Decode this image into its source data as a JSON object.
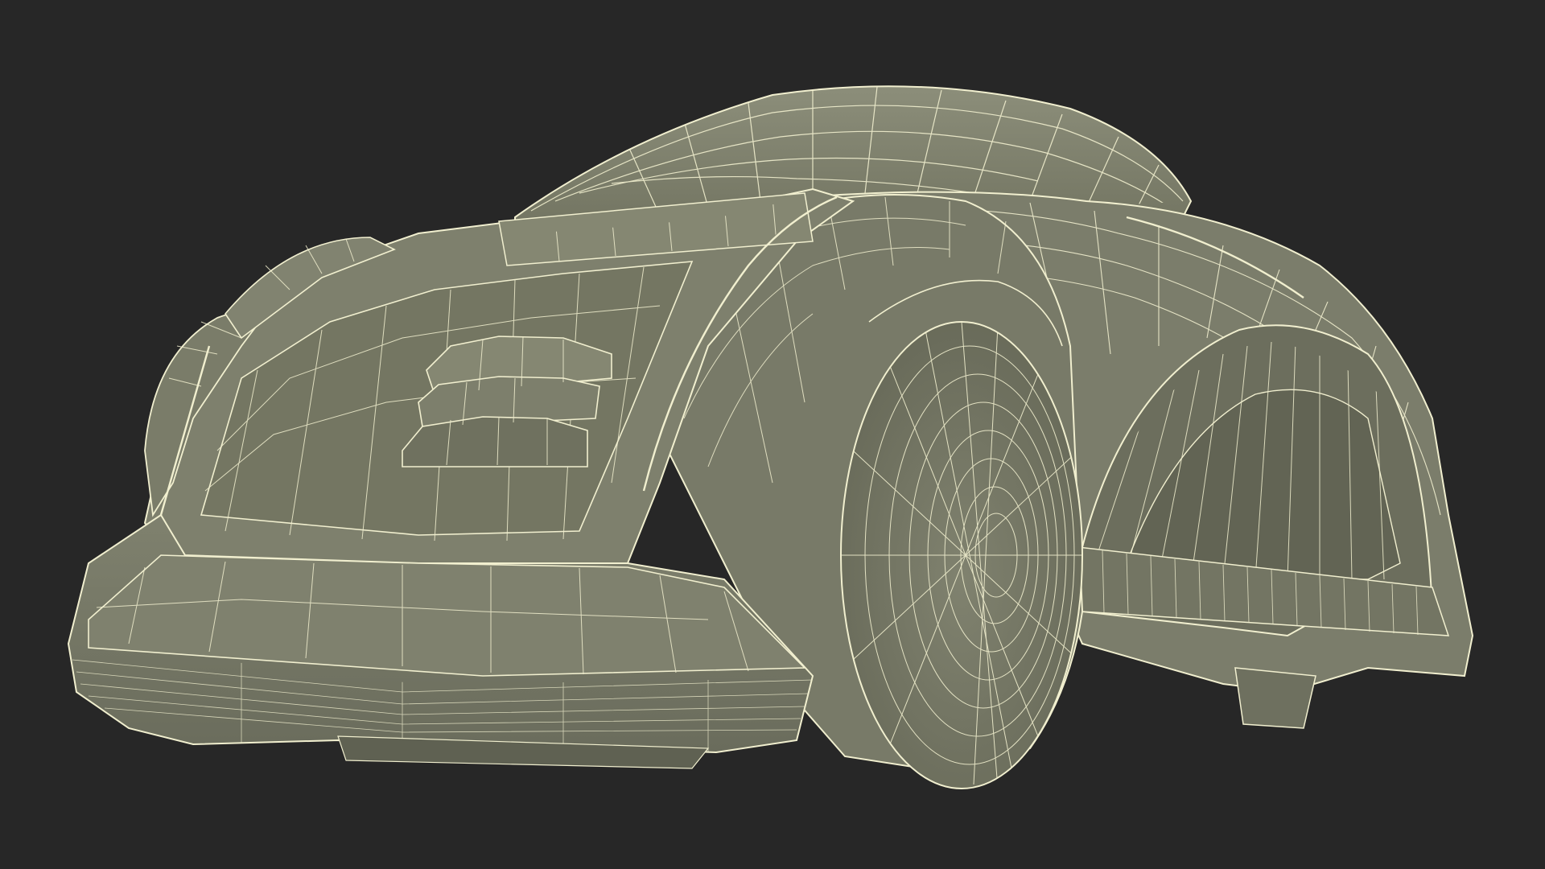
{
  "scene": {
    "background_color": "#272727",
    "body_fill": "#7d7f6d",
    "body_shade": "#6a6c5c",
    "body_light": "#8a8c78",
    "wire_color": "#f1efcf",
    "subject": "robotic-lawn-mower-wireframe"
  }
}
